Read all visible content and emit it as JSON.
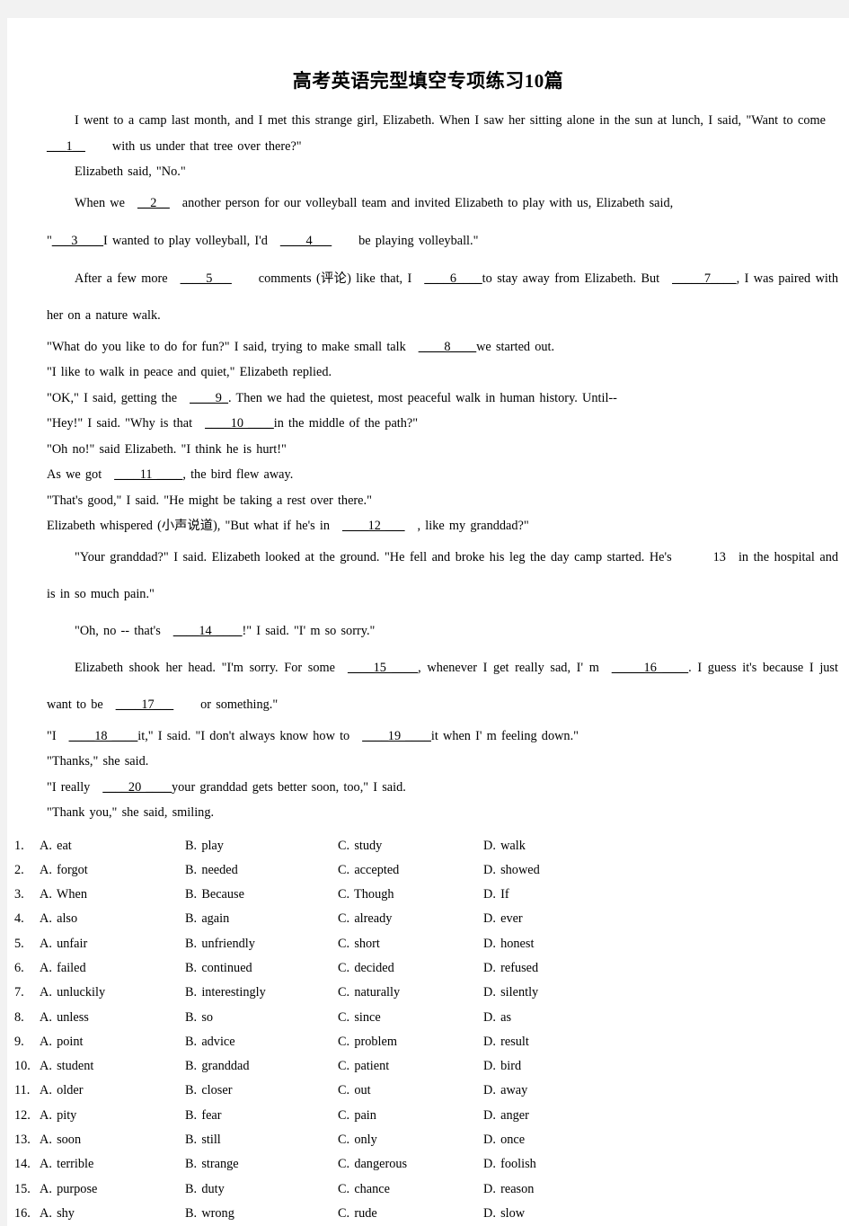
{
  "document": {
    "title": "高考英语完型填空专项练习10篇"
  },
  "passage": {
    "p1_a": "I went to a camp last month, and I met this strange girl, Elizabeth. When I saw her sitting alone in the sun at lunch, I said,",
    "p1_b_pre": "\"Want to come",
    "p1_blank": "___1__",
    "p1_b_post": "with us under that tree over there?\"",
    "p2": "Elizabeth said, \"No.\"",
    "p3_pre": "When we",
    "p3_blank": "__2__",
    "p3_mid": "another person for our volleyball team and invited Elizabeth to play with us, Elizabeth said,",
    "p4_pre": "\"",
    "p4_blank1": "___3____",
    "p4_mid": "I wanted to play volleyball, I'd",
    "p4_blank2": "____4___",
    "p4_post": "be playing volleyball.\"",
    "p5_pre": "After a few more",
    "p5_blank1": "____5___",
    "p5_mid1": "comments (评论) like that, I",
    "p5_blank2": "____6____",
    "p5_mid2": "to stay away from Elizabeth. But",
    "p5_blank3": "_____7____",
    "p5_post": ", I was paired with her on a nature walk.",
    "p6_pre": "\"What do you like to do for fun?\" I said, trying to make small talk",
    "p6_blank": "____8____",
    "p6_post": "we started out.",
    "p7": "\"I like to walk in peace and quiet,\" Elizabeth replied.",
    "p8_pre": "\"OK,\" I said, getting the",
    "p8_blank": "____9_",
    "p8_post": ". Then we had the quietest, most peaceful walk in human history. Until--",
    "p9_pre": "\"Hey!\" I said. \"Why is that",
    "p9_blank": "____10 ____",
    "p9_post": "in the middle of the path?\"",
    "p10": "\"Oh no!\" said Elizabeth. \"I think he is hurt!\"",
    "p11_pre": "As we got",
    "p11_blank": "____11 ____",
    "p11_post": ", the bird flew away.",
    "p12": "\"That's good,\" I said. \"He might be taking a rest over there.\"",
    "p13_pre": "Elizabeth whispered (小声说道), \"But what if he's in",
    "p13_blank": "____12 ___",
    "p13_post": ", like my granddad?\"",
    "p14_pre": "\"Your granddad?\" I said. Elizabeth looked at the ground. \"He fell and broke his leg the day camp started. He's",
    "p14_blank": "13",
    "p14_post": "in the hospital and is in so much pain.\"",
    "p15_pre": "\"Oh, no -- that's",
    "p15_blank": "____14 ____",
    "p15_post": "!\" I said. \"I' m so sorry.\"",
    "p16_pre": "Elizabeth shook her head. \"I'm sorry. For some",
    "p16_blank1": "____15 ____",
    "p16_mid1": ", whenever I get really sad, I' m",
    "p16_blank2": "_____16 ____",
    "p16_mid2": ". I guess it's because I just want to be",
    "p16_blank3": "____17___",
    "p16_post": "or something.\"",
    "p17_pre": "\"I",
    "p17_blank1": "____18 ____",
    "p17_mid": "it,\" I said. \"I don't always know how to",
    "p17_blank2": "____19 ____",
    "p17_post": "it when I' m feeling down.\"",
    "p18": "\"Thanks,\" she said.",
    "p19_pre": "\"I really",
    "p19_blank": "____20 ____",
    "p19_post": "your granddad gets better soon, too,\" I said.",
    "p20": "\"Thank you,\" she said, smiling."
  },
  "options": {
    "letters": [
      "A.",
      "B.",
      "C.",
      "D."
    ],
    "rows": [
      {
        "num": "1.",
        "a": "eat",
        "b": "play",
        "c": "study",
        "d": "walk"
      },
      {
        "num": "2.",
        "a": "forgot",
        "b": "needed",
        "c": "accepted",
        "d": "showed"
      },
      {
        "num": "3.",
        "a": "When",
        "b": "Because",
        "c": "Though",
        "d": "If"
      },
      {
        "num": "4.",
        "a": "also",
        "b": "again",
        "c": "already",
        "d": "ever"
      },
      {
        "num": "5.",
        "a": "unfair",
        "b": "unfriendly",
        "c": "short",
        "d": "honest"
      },
      {
        "num": "6.",
        "a": "failed",
        "b": "continued",
        "c": "decided",
        "d": "refused"
      },
      {
        "num": "7.",
        "a": "unluckily",
        "b": "interestingly",
        "c": "naturally",
        "d": "silently"
      },
      {
        "num": "8.",
        "a": "unless",
        "b": "so",
        "c": "since",
        "d": "as"
      },
      {
        "num": "9.",
        "a": "point",
        "b": "advice",
        "c": "problem",
        "d": "result"
      },
      {
        "num": "10.",
        "a": "student",
        "b": "granddad",
        "c": "patient",
        "d": "bird"
      },
      {
        "num": "11.",
        "a": "older",
        "b": "closer",
        "c": "out",
        "d": "away"
      },
      {
        "num": "12.",
        "a": "pity",
        "b": "fear",
        "c": "pain",
        "d": "anger"
      },
      {
        "num": "13.",
        "a": "soon",
        "b": "still",
        "c": "only",
        "d": "once"
      },
      {
        "num": "14.",
        "a": "terrible",
        "b": "strange",
        "c": "dangerous",
        "d": "foolish"
      },
      {
        "num": "15.",
        "a": "purpose",
        "b": "duty",
        "c": "chance",
        "d": "reason"
      },
      {
        "num": "16.",
        "a": "shy",
        "b": "wrong",
        "c": "rude",
        "d": "slow"
      }
    ]
  }
}
